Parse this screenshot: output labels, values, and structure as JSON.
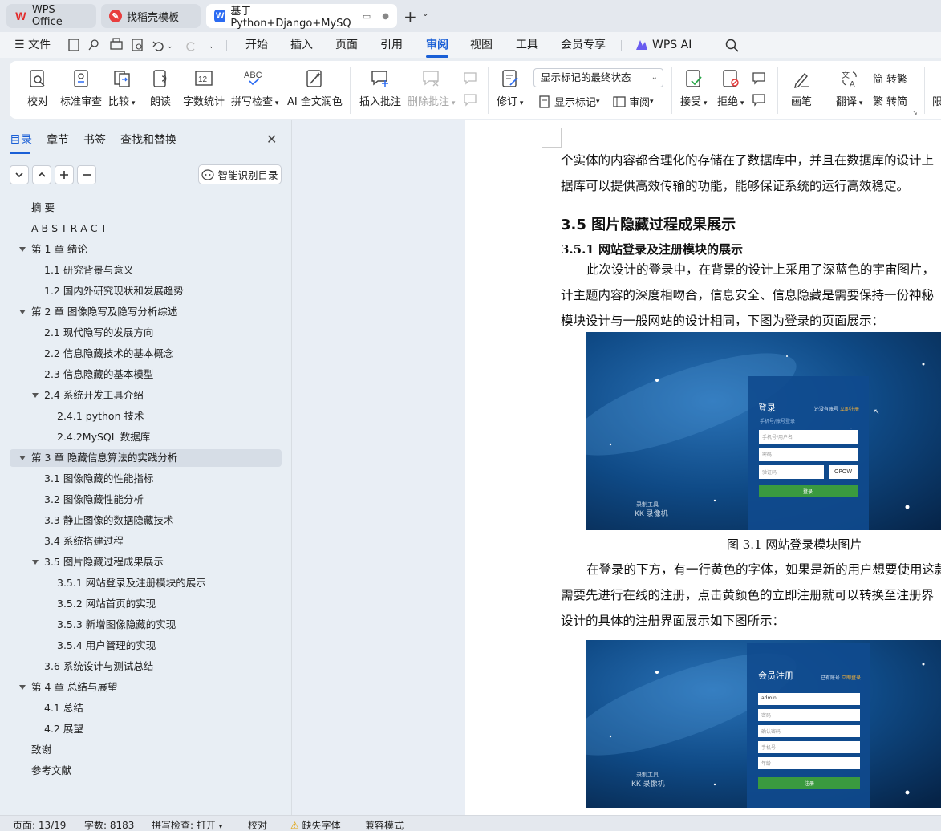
{
  "tabs": [
    {
      "label": "WPS Office"
    },
    {
      "label": "找稻壳模板"
    },
    {
      "label": "基于Python+Django+MySQ"
    }
  ],
  "menu": {
    "file": "文件",
    "items": [
      "开始",
      "插入",
      "页面",
      "引用",
      "审阅",
      "视图",
      "工具",
      "会员专享"
    ],
    "active": "审阅",
    "wps_ai": "WPS AI"
  },
  "ribbon": {
    "proofread": "校对",
    "standard_review": "标准审查",
    "compare": "比较",
    "read_aloud": "朗读",
    "word_count": "字数统计",
    "spell_check": "拼写检查",
    "ai_polish": "AI 全文润色",
    "insert_comment": "插入批注",
    "delete_comment": "删除批注",
    "track_changes": "修订",
    "markup_state": "显示标记的最终状态",
    "show_markup": "显示标记",
    "review": "审阅",
    "accept": "接受",
    "reject": "拒绝",
    "pen": "画笔",
    "translate": "翻译",
    "to_traditional": "转繁",
    "to_simplified": "转简",
    "limit": "限"
  },
  "nav": {
    "tabs": [
      "目录",
      "章节",
      "书签",
      "查找和替换"
    ],
    "smart_toc": "智能识别目录",
    "toc": [
      {
        "label": "摘  要",
        "level": 0,
        "arrow": false
      },
      {
        "label": "A B S T R A C T",
        "level": 0,
        "arrow": false
      },
      {
        "label": "第 1 章  绪论",
        "level": 0,
        "arrow": true
      },
      {
        "label": "1.1  研究背景与意义",
        "level": 1,
        "arrow": false
      },
      {
        "label": "1.2  国内外研究现状和发展趋势",
        "level": 1,
        "arrow": false
      },
      {
        "label": "第 2 章  图像隐写及隐写分析综述",
        "level": 0,
        "arrow": true
      },
      {
        "label": "2.1  现代隐写的发展方向",
        "level": 1,
        "arrow": false
      },
      {
        "label": "2.2 信息隐藏技术的基本概念",
        "level": 1,
        "arrow": false
      },
      {
        "label": "2.3 信息隐藏的基本模型",
        "level": 1,
        "arrow": false
      },
      {
        "label": "2.4 系统开发工具介绍",
        "level": 1,
        "arrow": true
      },
      {
        "label": "2.4.1 python 技术",
        "level": 2,
        "arrow": false
      },
      {
        "label": "2.4.2MySQL 数据库",
        "level": 2,
        "arrow": false
      },
      {
        "label": "第 3 章  隐藏信息算法的实践分析",
        "level": 0,
        "arrow": true,
        "selected": true
      },
      {
        "label": "3.1  图像隐藏的性能指标",
        "level": 1,
        "arrow": false
      },
      {
        "label": "3.2  图像隐藏性能分析",
        "level": 1,
        "arrow": false
      },
      {
        "label": "3.3 静止图像的数据隐藏技术",
        "level": 1,
        "arrow": false
      },
      {
        "label": "3.4  系统搭建过程",
        "level": 1,
        "arrow": false
      },
      {
        "label": "3.5  图片隐藏过程成果展示",
        "level": 1,
        "arrow": true
      },
      {
        "label": "3.5.1 网站登录及注册模块的展示",
        "level": 2,
        "arrow": false
      },
      {
        "label": "3.5.2 网站首页的实现",
        "level": 2,
        "arrow": false
      },
      {
        "label": "3.5.3 新增图像隐藏的实现",
        "level": 2,
        "arrow": false
      },
      {
        "label": "3.5.4 用户管理的实现",
        "level": 2,
        "arrow": false
      },
      {
        "label": "3.6 系统设计与测试总结",
        "level": 1,
        "arrow": false
      },
      {
        "label": "第 4 章  总结与展望",
        "level": 0,
        "arrow": true
      },
      {
        "label": "4.1 总结",
        "level": 1,
        "arrow": false
      },
      {
        "label": "4.2 展望",
        "level": 1,
        "arrow": false
      },
      {
        "label": "致谢",
        "level": 0,
        "arrow": false
      },
      {
        "label": "参考文献",
        "level": 0,
        "arrow": false
      }
    ]
  },
  "document": {
    "line1": "个实体的内容都合理化的存储在了数据库中，并且在数据库的设计上",
    "line2": "据库可以提供高效传输的功能，能够保证系统的运行高效稳定。",
    "heading_35": "3.5  图片隐藏过程成果展示",
    "heading_351": "3.5.1 网站登录及注册模块的展示",
    "p1": "此次设计的登录中，在背景的设计上采用了深蓝色的宇宙图片，",
    "p2": "计主题内容的深度相吻合，信息安全、信息隐藏是需要保持一份神秘",
    "p3": "模块设计与一般网站的设计相同，下图为登录的页面展示：",
    "caption1": "图 3.1 网站登录模块图片",
    "p4": "在登录的下方，有一行黄色的字体，如果是新的用户想要使用这款",
    "p5": "需要先进行在线的注册，点击黄颜色的立即注册就可以转换至注册界",
    "p6": "设计的具体的注册界面展示如下图所示：",
    "login_shot": {
      "title": "登录",
      "hint": "还没有账号",
      "link": "立即注册",
      "sub": "手机号/账号登录",
      "field1": "手机号/用户名",
      "field2": "密码",
      "field3": "验证码",
      "captcha": "OPOW",
      "button": "登录",
      "watermark1": "录制工具",
      "watermark2": "KK 录像机"
    },
    "register_shot": {
      "title": "会员注册",
      "hint": "已有账号",
      "link": "立即登录",
      "field1": "admin",
      "field2": "密码",
      "field3": "确认密码",
      "field4": "手机号",
      "field5": "年龄",
      "button": "注册",
      "watermark1": "录制工具",
      "watermark2": "KK 录像机"
    }
  },
  "status": {
    "page": "页面: 13/19",
    "words": "字数: 8183",
    "spell": "拼写检查: 打开",
    "proof": "校对",
    "missing_font": "缺失字体",
    "compat": "兼容模式"
  },
  "colors": {
    "accent": "#1a5fd6",
    "space_bg": "#0d3d73",
    "button_green": "#3a9a3f"
  }
}
